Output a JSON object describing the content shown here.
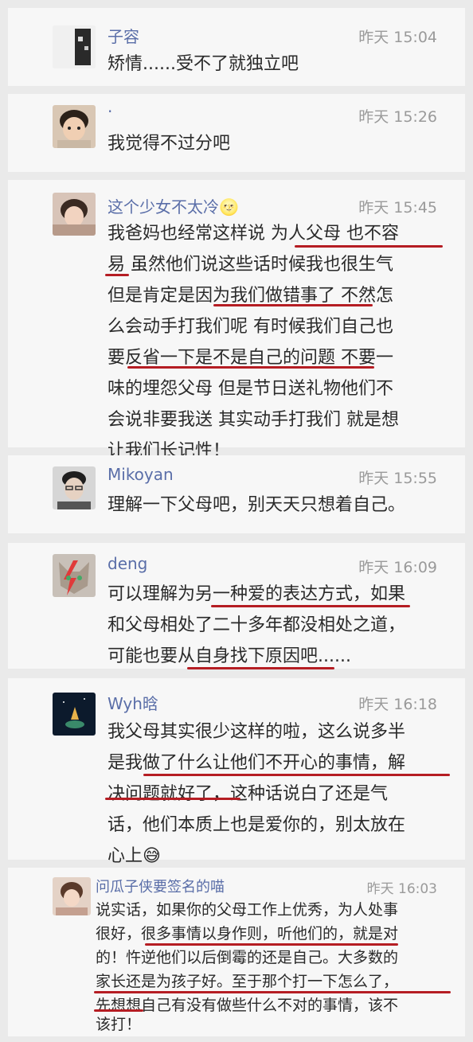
{
  "comments": [
    {
      "name": "子容",
      "time": "昨天 15:04",
      "lines": [
        "矫情......受不了就独立吧"
      ]
    },
    {
      "name": "·",
      "time": "昨天 15:26",
      "lines": [
        "我觉得不过分吧"
      ]
    },
    {
      "name": "这个少女不太冷🌝",
      "time": "昨天 15:45",
      "lines": [
        "我爸妈也经常这样说 为人父母 也不容",
        "易 虽然他们说这些话时候我也很生气",
        "但是肯定是因为我们做错事了 不然怎",
        "么会动手打我们呢 有时候我们自己也",
        "要反省一下是不是自己的问题 不要一",
        "味的埋怨父母 但是节日送礼物他们不",
        "会说非要我送 其实动手打我们 就是想",
        "让我们长记性！"
      ]
    },
    {
      "name": "Mikoyan",
      "time": "昨天 15:55",
      "lines": [
        "理解一下父母吧，别天天只想着自己。"
      ]
    },
    {
      "name": "deng",
      "time": "昨天 16:09",
      "lines": [
        "可以理解为另一种爱的表达方式，如果",
        "和父母相处了二十多年都没相处之道，",
        "可能也要从自身找下原因吧......"
      ]
    },
    {
      "name": "Wyh晗",
      "time": "昨天 16:18",
      "lines": [
        "我父母其实很少这样的啦，这么说多半",
        "是我做了什么让他们不开心的事情，解",
        "决问题就好了，这种话说白了还是气",
        "话，他们本质上也是爱你的，别太放在",
        "心上😅"
      ]
    },
    {
      "name": "问瓜子侠要签名的喵",
      "time": "昨天 16:03",
      "lines": [
        "说实话，如果你的父母工作上优秀，为人处事",
        "很好，很多事情以身作则，听他们的，就是对",
        "的！忤逆他们以后倒霉的还是自己。大多数的",
        "家长还是为孩子好。至于那个打一下怎么了，",
        "先想想自己有没有做些什么不对的事情，该不",
        "该打！"
      ]
    }
  ]
}
